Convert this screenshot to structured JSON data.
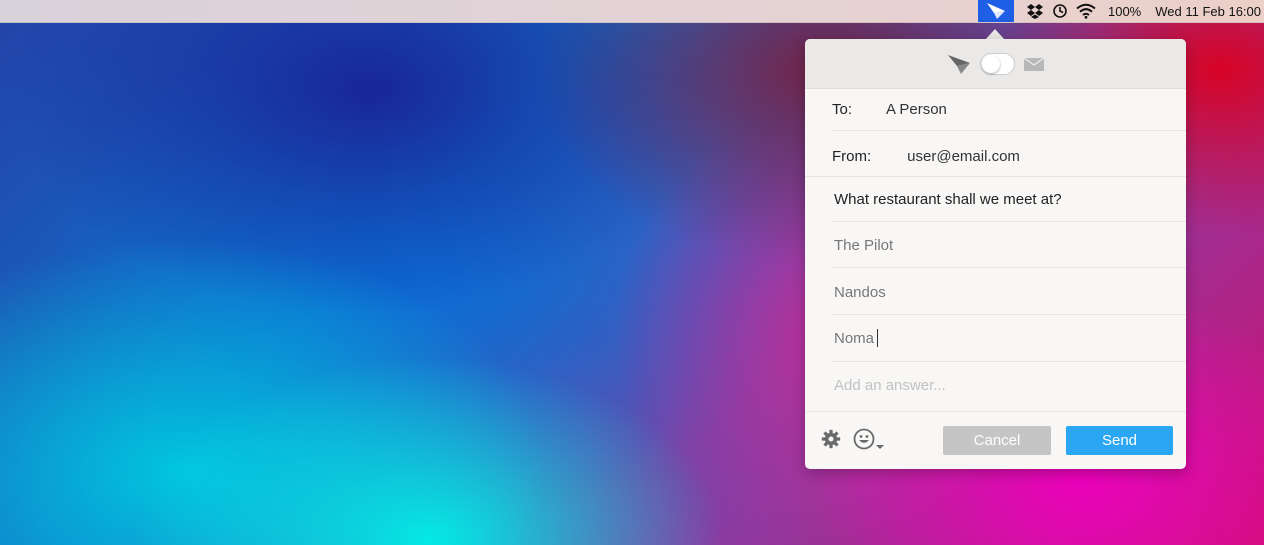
{
  "menubar": {
    "app_icon": "paper-plane-icon",
    "icons": [
      "dropbox-icon",
      "clock-icon",
      "wifi-icon"
    ],
    "battery": "100%",
    "clock": "Wed 11 Feb 16:00"
  },
  "popover": {
    "header": {
      "left_icon": "paper-plane-icon",
      "toggle_state": "off",
      "right_icon": "envelope-icon"
    },
    "to_label": "To:",
    "to_value": "A Person",
    "from_label": "From:",
    "from_value": "user@email.com",
    "question": "What restaurant shall we meet at?",
    "answers": [
      "The Pilot",
      "Nandos",
      "Noma"
    ],
    "add_answer_placeholder": "Add an answer...",
    "footer": {
      "settings_icon": "gear-icon",
      "emoji_icon": "smiley-icon",
      "cancel_label": "Cancel",
      "send_label": "Send"
    }
  },
  "colors": {
    "menubar_app_highlight": "#1e5fe6",
    "send_button": "#2aa6f2",
    "cancel_button_disabled": "#c5c5c5"
  }
}
